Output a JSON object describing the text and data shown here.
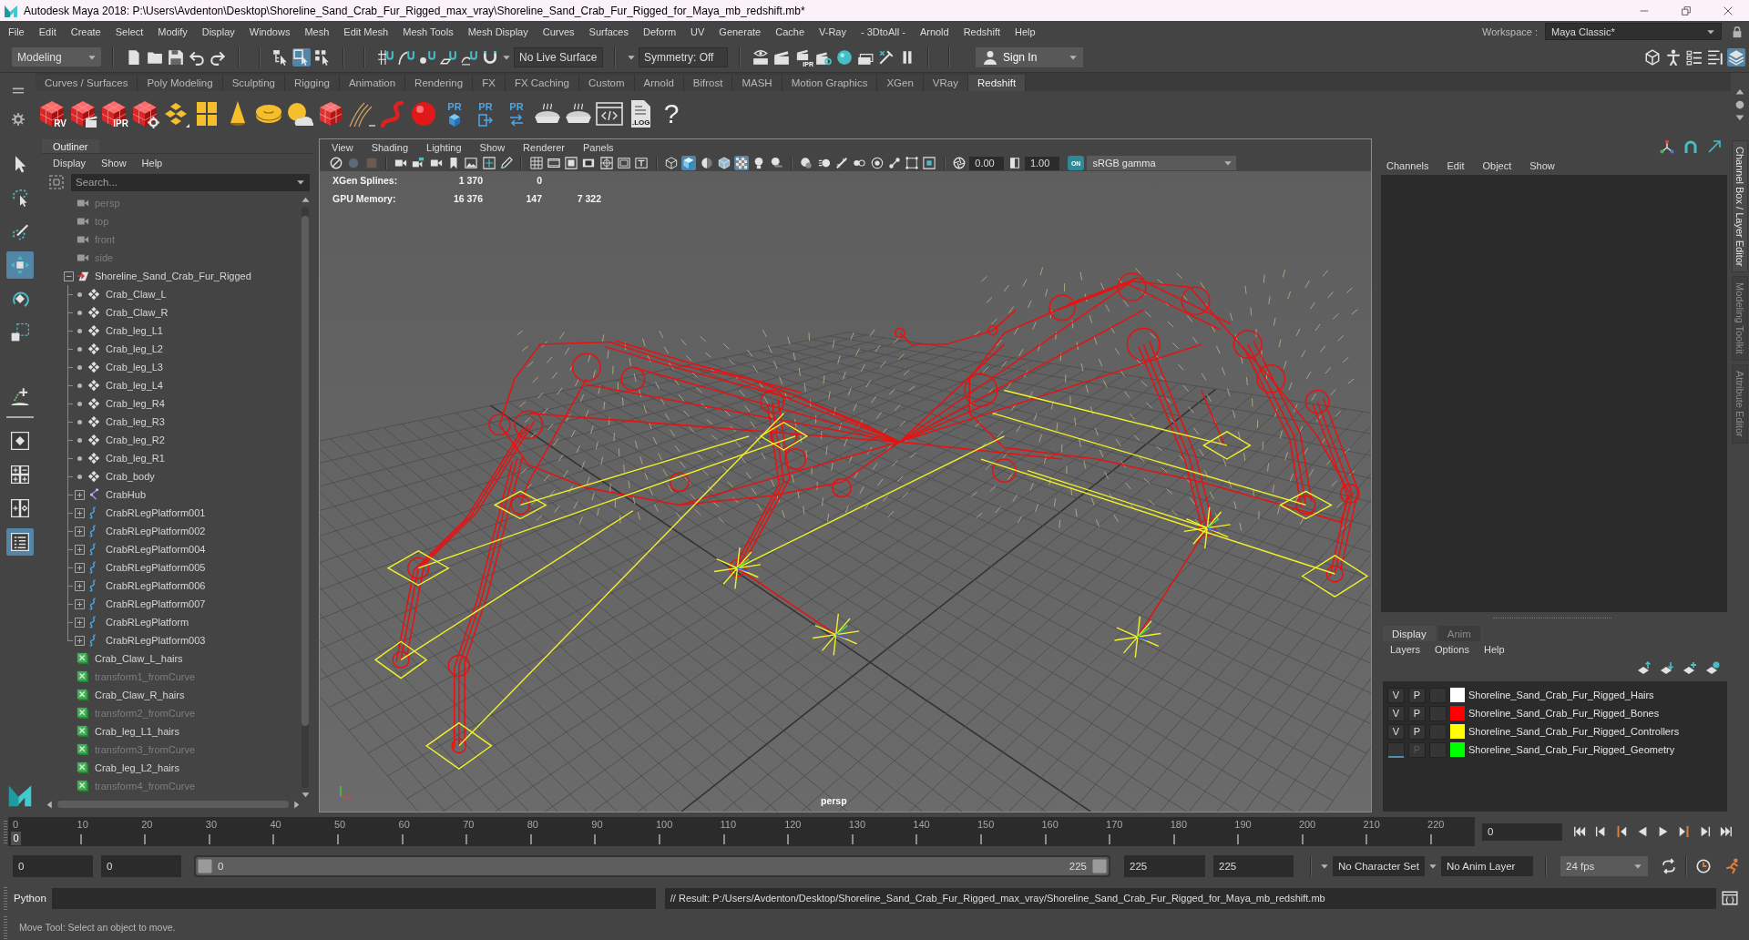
{
  "window": {
    "title": "Autodesk Maya 2018: P:\\Users\\Avdenton\\Desktop\\Shoreline_Sand_Crab_Fur_Rigged_max_vray\\Shoreline_Sand_Crab_Fur_Rigged_for_Maya_mb_redshift.mb*"
  },
  "menu_bar": [
    "File",
    "Edit",
    "Create",
    "Select",
    "Modify",
    "Display",
    "Windows",
    "Mesh",
    "Edit Mesh",
    "Mesh Tools",
    "Mesh Display",
    "Curves",
    "Surfaces",
    "Deform",
    "UV",
    "Generate",
    "Cache",
    "V-Ray",
    "- 3DtoAll -",
    "Arnold",
    "Redshift",
    "Help"
  ],
  "workspace": {
    "label": "Workspace :",
    "value": "Maya Classic*"
  },
  "status_line": {
    "mode": "Modeling",
    "select_modes": [
      {
        "selected": false
      },
      {
        "selected": true
      },
      {
        "selected": false
      }
    ],
    "live_surface": "No Live Surface",
    "symmetry": "Symmetry: Off",
    "render_badge": "IPR",
    "sign_in": "Sign In",
    "panel_toggles": [
      {
        "selected": false
      },
      {
        "selected": false
      },
      {
        "selected": false
      },
      {
        "selected": false
      },
      {
        "selected": true
      }
    ]
  },
  "shelf": {
    "tabs": [
      {
        "label": "Curves / Surfaces",
        "selected": false
      },
      {
        "label": "Poly Modeling",
        "selected": false
      },
      {
        "label": "Sculpting",
        "selected": false
      },
      {
        "label": "Rigging",
        "selected": false
      },
      {
        "label": "Animation",
        "selected": false
      },
      {
        "label": "Rendering",
        "selected": false
      },
      {
        "label": "FX",
        "selected": false
      },
      {
        "label": "FX Caching",
        "selected": false
      },
      {
        "label": "Custom",
        "selected": false
      },
      {
        "label": "Arnold",
        "selected": false
      },
      {
        "label": "Bifrost",
        "selected": false
      },
      {
        "label": "MASH",
        "selected": false
      },
      {
        "label": "Motion Graphics",
        "selected": false
      },
      {
        "label": "XGen",
        "selected": false
      },
      {
        "label": "VRay",
        "selected": false
      },
      {
        "label": "Redshift",
        "selected": true
      }
    ],
    "icon_texts": [
      "RV",
      "IPR",
      "PR",
      "PR",
      "PR",
      ".LOG",
      "?"
    ]
  },
  "toolbox": {
    "tools": [
      {
        "selected": false
      },
      {
        "selected": false
      },
      {
        "selected": false
      },
      {
        "selected": true
      },
      {
        "selected": false
      },
      {
        "selected": false
      }
    ],
    "layouts": [
      {
        "selected": false
      },
      {
        "selected": false
      },
      {
        "selected": false
      },
      {
        "selected": true
      }
    ]
  },
  "outliner": {
    "title": "Outliner",
    "menu": [
      "Display",
      "Show",
      "Help"
    ],
    "search": {
      "placeholder": "Search..."
    },
    "items": [
      {
        "label": "persp",
        "kind": "camera",
        "hidden": true
      },
      {
        "label": "top",
        "kind": "camera",
        "hidden": true
      },
      {
        "label": "front",
        "kind": "camera",
        "hidden": true
      },
      {
        "label": "side",
        "kind": "camera",
        "hidden": true
      },
      {
        "label": "Shoreline_Sand_Crab_Fur_Rigged",
        "kind": "group",
        "hidden": false,
        "expanded": true,
        "children": [
          {
            "label": "Crab_Claw_L",
            "kind": "locator",
            "hidden": false
          },
          {
            "label": "Crab_Claw_R",
            "kind": "locator",
            "hidden": false
          },
          {
            "label": "Crab_leg_L1",
            "kind": "locator",
            "hidden": false
          },
          {
            "label": "Crab_leg_L2",
            "kind": "locator",
            "hidden": false
          },
          {
            "label": "Crab_leg_L3",
            "kind": "locator",
            "hidden": false
          },
          {
            "label": "Crab_leg_L4",
            "kind": "locator",
            "hidden": false
          },
          {
            "label": "Crab_leg_R4",
            "kind": "locator",
            "hidden": false
          },
          {
            "label": "Crab_leg_R3",
            "kind": "locator",
            "hidden": false
          },
          {
            "label": "Crab_leg_R2",
            "kind": "locator",
            "hidden": false
          },
          {
            "label": "Crab_leg_R1",
            "kind": "locator",
            "hidden": false
          },
          {
            "label": "Crab_body",
            "kind": "locator",
            "hidden": false
          },
          {
            "label": "CrabHub",
            "kind": "joint",
            "hidden": false,
            "expanded": false
          },
          {
            "label": "CrabRLegPlatform001",
            "kind": "curve",
            "hidden": false,
            "expanded": false
          },
          {
            "label": "CrabRLegPlatform002",
            "kind": "curve",
            "hidden": false,
            "expanded": false
          },
          {
            "label": "CrabRLegPlatform004",
            "kind": "curve",
            "hidden": false,
            "expanded": false
          },
          {
            "label": "CrabRLegPlatform005",
            "kind": "curve",
            "hidden": false,
            "expanded": false
          },
          {
            "label": "CrabRLegPlatform006",
            "kind": "curve",
            "hidden": false,
            "expanded": false
          },
          {
            "label": "CrabRLegPlatform007",
            "kind": "curve",
            "hidden": false,
            "expanded": false
          },
          {
            "label": "CrabRLegPlatform",
            "kind": "curve",
            "hidden": false,
            "expanded": false
          },
          {
            "label": "CrabRLegPlatform003",
            "kind": "curve",
            "hidden": false,
            "expanded": false
          }
        ]
      },
      {
        "label": "Crab_Claw_L_hairs",
        "kind": "xgen",
        "hidden": false
      },
      {
        "label": "transform1_fromCurve",
        "kind": "xgen",
        "hidden": true
      },
      {
        "label": "Crab_Claw_R_hairs",
        "kind": "xgen",
        "hidden": false
      },
      {
        "label": "transform2_fromCurve",
        "kind": "xgen",
        "hidden": true
      },
      {
        "label": "Crab_leg_L1_hairs",
        "kind": "xgen",
        "hidden": false
      },
      {
        "label": "transform3_fromCurve",
        "kind": "xgen",
        "hidden": true
      },
      {
        "label": "Crab_leg_L2_hairs",
        "kind": "xgen",
        "hidden": false
      },
      {
        "label": "transform4_fromCurve",
        "kind": "xgen",
        "hidden": true
      }
    ]
  },
  "viewport": {
    "menu": [
      "View",
      "Shading",
      "Lighting",
      "Show",
      "Renderer",
      "Panels"
    ],
    "toolbar": [
      {
        "selected": false
      },
      {
        "selected": false
      },
      {
        "selected": false
      },
      {
        "selected": false
      },
      {
        "selected": false
      },
      {
        "selected": false
      },
      {
        "selected": false
      },
      {
        "selected": false
      },
      {
        "selected": false
      },
      {
        "selected": false
      },
      {
        "selected": false
      },
      {
        "selected": false
      },
      {
        "selected": false
      },
      {
        "selected": false
      },
      {
        "selected": false
      },
      {
        "selected": false
      },
      {
        "selected": false
      },
      {
        "selected": false
      },
      {
        "selected": true
      },
      {
        "selected": false
      },
      {
        "selected": false
      },
      {
        "selected": true
      },
      {
        "selected": false
      },
      {
        "selected": false
      },
      {
        "selected": false
      },
      {
        "selected": false
      },
      {
        "selected": false
      },
      {
        "selected": false
      },
      {
        "selected": false
      },
      {
        "selected": false
      },
      {
        "selected": false
      },
      {
        "selected": false
      }
    ],
    "exposure": "0.00",
    "gamma": "1.00",
    "color_management": {
      "label": "ON",
      "selected": true
    },
    "color_space": "sRGB gamma",
    "hud": [
      {
        "label": "XGen Splines:",
        "values": [
          "1 370",
          "0"
        ]
      },
      {
        "label": "GPU Memory:",
        "values": [
          "16 376",
          "147",
          "7 322"
        ]
      }
    ],
    "camera": "persp"
  },
  "channel_box": {
    "menu": [
      "Channels",
      "Edit",
      "Object",
      "Show"
    ]
  },
  "layer_editor": {
    "tabs": [
      {
        "label": "Display",
        "selected": true
      },
      {
        "label": "Anim",
        "selected": false
      }
    ],
    "menu": [
      "Layers",
      "Options",
      "Help"
    ],
    "layers": [
      {
        "visible": true,
        "v_label": "V",
        "playback": true,
        "p_label": "P",
        "color": "#ffffff",
        "name": "Shoreline_Sand_Crab_Fur_Rigged_Hairs"
      },
      {
        "visible": true,
        "v_label": "V",
        "playback": true,
        "p_label": "P",
        "color": "#ff0000",
        "name": "Shoreline_Sand_Crab_Fur_Rigged_Bones"
      },
      {
        "visible": true,
        "v_label": "V",
        "playback": true,
        "p_label": "P",
        "color": "#ffff00",
        "name": "Shoreline_Sand_Crab_Fur_Rigged_Controllers"
      },
      {
        "visible": false,
        "playback": false,
        "p_label": "P",
        "color": "#00ff00",
        "name": "Shoreline_Sand_Crab_Fur_Rigged_Geometry"
      }
    ]
  },
  "side_tabs": [
    {
      "label": "Channel Box / Layer Editor",
      "selected": true
    },
    {
      "label": "Modeling Toolkit",
      "selected": false
    },
    {
      "label": "Attribute Editor",
      "selected": false
    }
  ],
  "time_slider": {
    "ticks": [
      "0",
      "10",
      "20",
      "30",
      "40",
      "50",
      "60",
      "70",
      "80",
      "90",
      "100",
      "110",
      "120",
      "130",
      "140",
      "150",
      "160",
      "170",
      "180",
      "190",
      "200",
      "210",
      "220"
    ],
    "current_frame": "0",
    "level": 0,
    "frame_field": "0"
  },
  "range_slider": {
    "start": "0",
    "playback_start": "0",
    "range_start": "0",
    "range_end": "225",
    "level": 1,
    "playback_end": "225",
    "end": "225",
    "character_set": "No Character Set",
    "anim_layer": "No Anim Layer",
    "fps": "24 fps"
  },
  "command_line": {
    "language": "Python",
    "result": "// Result: P:/Users/Avdenton/Desktop/Shoreline_Sand_Crab_Fur_Rigged_max_vray/Shoreline_Sand_Crab_Fur_Rigged_for_Maya_mb_redshift.mb"
  },
  "help_line": "Move Tool: Select an object to move."
}
